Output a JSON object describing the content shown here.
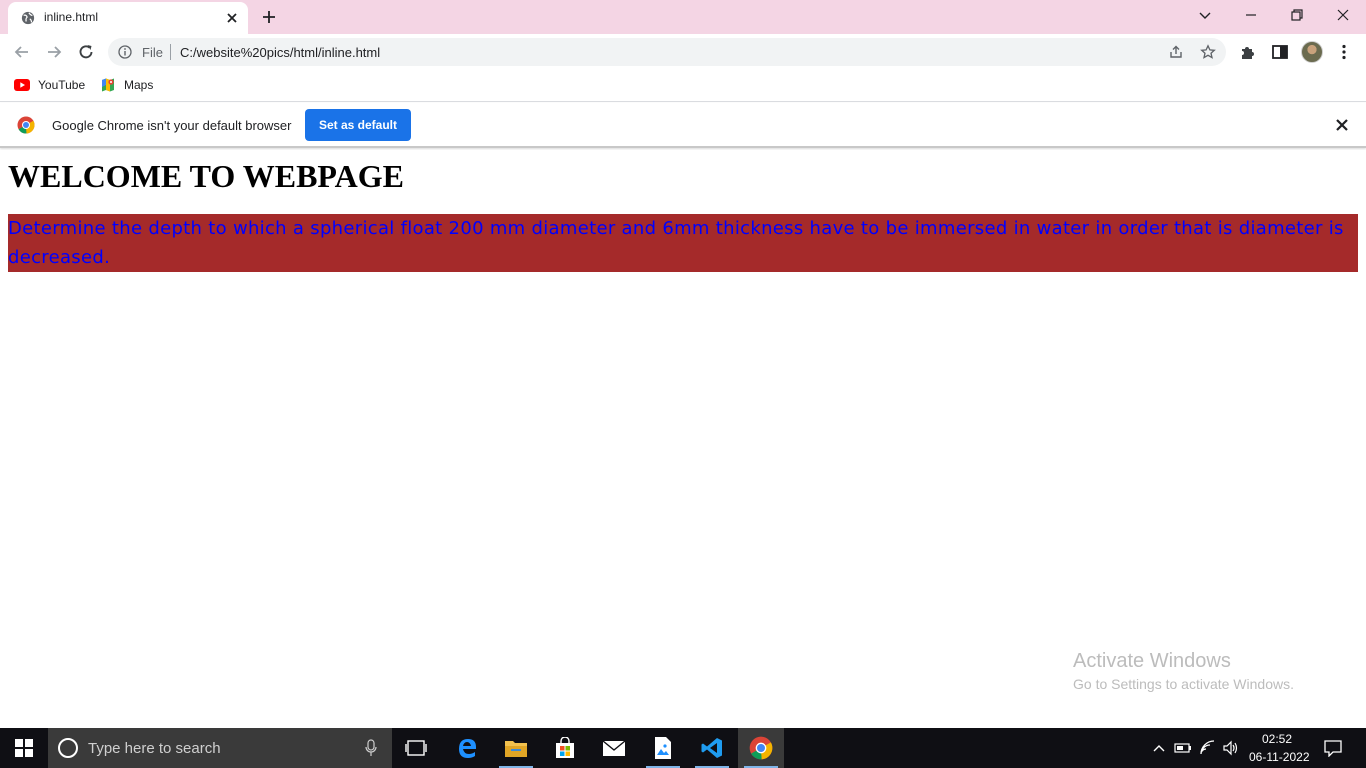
{
  "browser": {
    "tab": {
      "title": "inline.html"
    },
    "omnibox": {
      "scheme_label": "File",
      "url": "C:/website%20pics/html/inline.html"
    },
    "bookmarks": [
      {
        "label": "YouTube",
        "icon": "youtube-icon"
      },
      {
        "label": "Maps",
        "icon": "maps-icon"
      }
    ],
    "infobar": {
      "message": "Google Chrome isn't your default browser",
      "button_label": "Set as default"
    }
  },
  "page": {
    "heading": "WELCOME TO WEBPAGE",
    "paragraph": "Determine the depth to which a spherical float 200 mm diameter and 6mm thickness have to be immersed in water in order that is diameter is decreased.",
    "paragraph_bg": "#a52a2a",
    "paragraph_color": "#0000ff"
  },
  "watermark": {
    "title": "Activate Windows",
    "subtitle": "Go to Settings to activate Windows."
  },
  "taskbar": {
    "search_placeholder": "Type here to search",
    "clock_time": "02:52",
    "clock_date": "06-11-2022"
  },
  "colors": {
    "tabstrip": "#f4d5e4",
    "accent_button": "#1a73e8"
  }
}
